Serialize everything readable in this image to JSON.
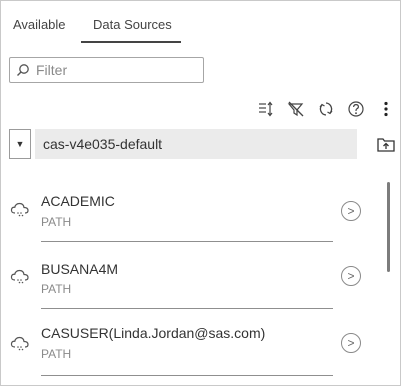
{
  "tabs": [
    {
      "label": "Available",
      "active": false
    },
    {
      "label": "Data Sources",
      "active": true
    }
  ],
  "filter": {
    "placeholder": "Filter",
    "value": ""
  },
  "toolbar": {
    "icons": [
      "sort-icon",
      "hide-filter-icon",
      "refresh-icon",
      "help-icon",
      "more-vertical-icon"
    ]
  },
  "server": {
    "selected": "cas-v4e035-default"
  },
  "libraries": [
    {
      "name": "ACADEMIC",
      "type": "PATH"
    },
    {
      "name": "BUSANA4M",
      "type": "PATH"
    },
    {
      "name": "CASUSER(Linda.Jordan@sas.com)",
      "type": "PATH"
    }
  ],
  "colors": {
    "border": "#c9c9c9",
    "dropdown_bg": "#ebebeb",
    "text": "#333333",
    "subtext": "#8a8a8a"
  }
}
